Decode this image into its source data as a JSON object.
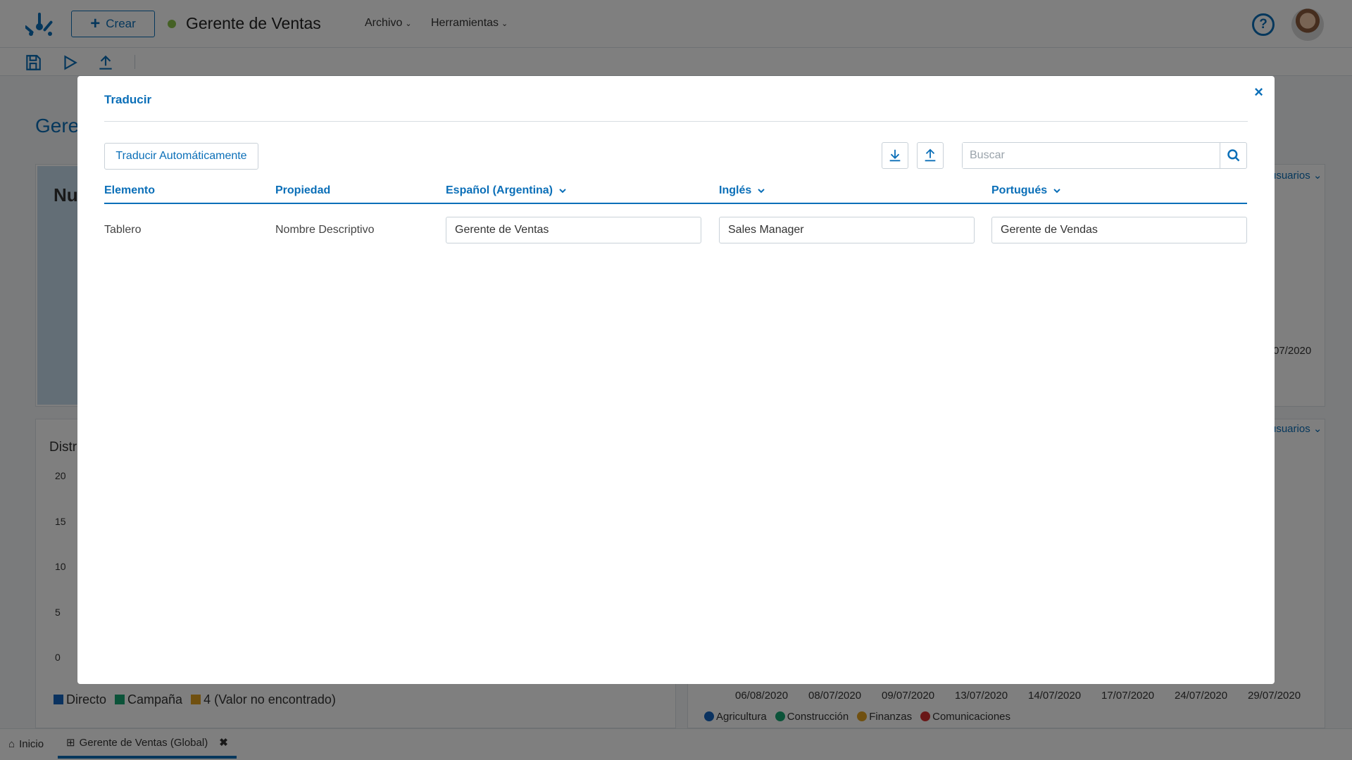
{
  "topbar": {
    "create_label": "Crear",
    "app_title": "Gerente de Ventas",
    "menu_file": "Archivo",
    "menu_tools": "Herramientas",
    "help_icon": "?"
  },
  "dashboard": {
    "title_partial": "Gere",
    "panel1_label_partial": "Nu",
    "panel2_label_partial": "Distr",
    "y_ticks": [
      "20",
      "15",
      "10",
      "5",
      "0"
    ],
    "legend_left": [
      "Directo",
      "Campaña",
      "4 (Valor no encontrado)"
    ],
    "legend_left_colors": [
      "#1565c0",
      "#17a673",
      "#e0a020"
    ],
    "usuarios_label": "usuarios",
    "right_top_date": "07/2020",
    "x_dates": [
      "06/08/2020",
      "08/07/2020",
      "09/07/2020",
      "13/07/2020",
      "14/07/2020",
      "17/07/2020",
      "24/07/2020",
      "29/07/2020"
    ],
    "legend_right": [
      "Agricultura",
      "Construcción",
      "Finanzas",
      "Comunicaciones"
    ],
    "legend_right_colors": [
      "#1565c0",
      "#17a673",
      "#e0a020",
      "#d32f2f"
    ]
  },
  "bottom_tabs": {
    "home": "Inicio",
    "current": "Gerente de Ventas (Global)",
    "close": "✖"
  },
  "modal": {
    "title": "Traducir",
    "close": "×",
    "auto_translate": "Traducir Automáticamente",
    "search_placeholder": "Buscar",
    "columns": {
      "element": "Elemento",
      "property": "Propiedad",
      "lang1": "Español (Argentina)",
      "lang2": "Inglés",
      "lang3": "Portugués"
    },
    "rows": [
      {
        "element": "Tablero",
        "property": "Nombre Descriptivo",
        "lang1": "Gerente de Ventas",
        "lang2": "Sales Manager",
        "lang3": "Gerente de Vendas"
      }
    ]
  },
  "colors": {
    "accent": "#0b6fb8",
    "status_dot": "#8bc34a"
  }
}
